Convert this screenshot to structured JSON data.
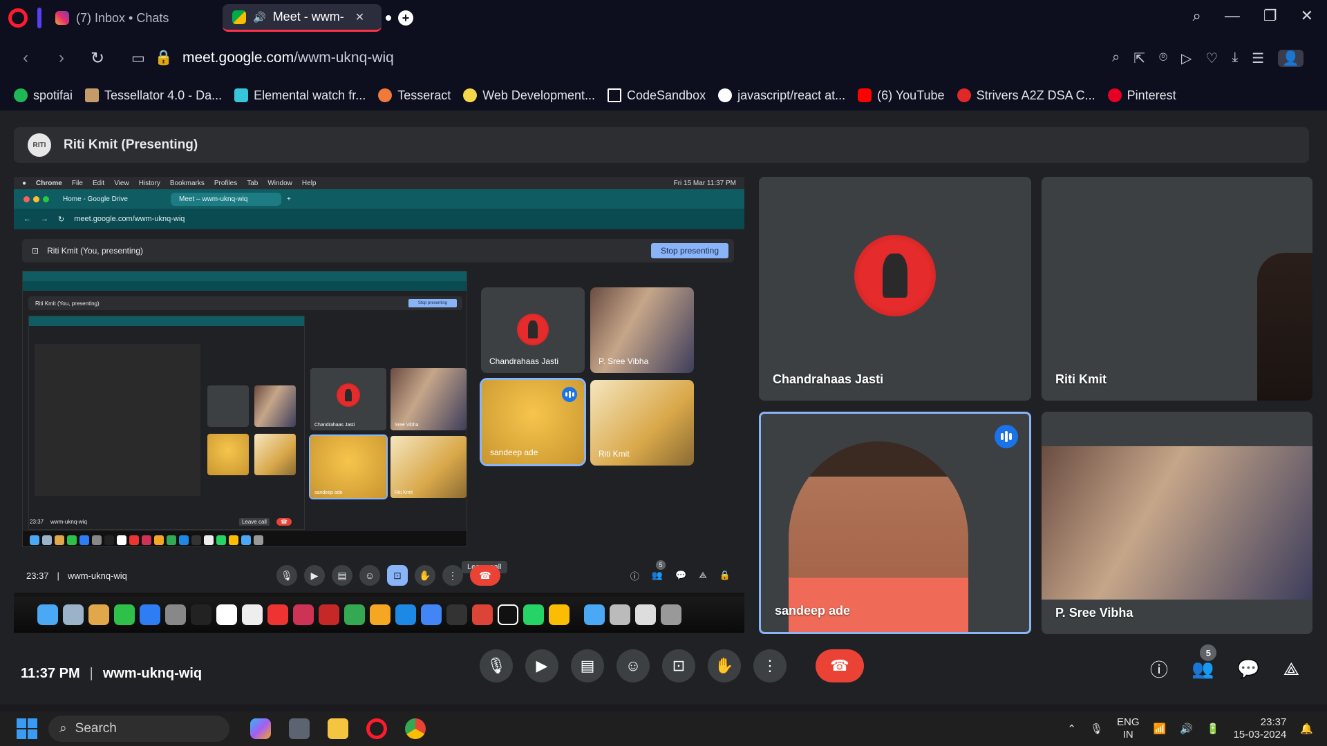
{
  "browser": {
    "tabs": [
      {
        "label": "(7) Inbox • Chats",
        "active": false
      },
      {
        "label": "Meet - wwm-",
        "active": true
      }
    ],
    "url_host": "meet.google.com",
    "url_path": "/wwm-uknq-wiq",
    "bookmarks": [
      "spotifai",
      "Tessellator 4.0 - Da...",
      "Elemental watch fr...",
      "Tesseract",
      "Web Development...",
      "CodeSandbox",
      "javascript/react at...",
      "(6) YouTube",
      "Strivers A2Z DSA C...",
      "Pinterest"
    ]
  },
  "meet": {
    "presenter_avatar_text": "RITI",
    "presenter_bar": "Riti Kmit (Presenting)",
    "shared_screen": {
      "menubar": [
        "Chrome",
        "File",
        "Edit",
        "View",
        "History",
        "Bookmarks",
        "Profiles",
        "Tab",
        "Window",
        "Help"
      ],
      "menubar_clock": "Fri 15 Mar  11:37 PM",
      "inner_tabs": [
        "Home - Google Drive",
        "Meet – wwm-uknq-wiq"
      ],
      "inner_url": "meet.google.com/wwm-uknq-wiq",
      "inner_presenting": "Riti Kmit (You, presenting)",
      "stop_presenting": "Stop presenting",
      "nested_presenting": "Riti Kmit (You, presenting)",
      "nested_stop": "Stop presenting",
      "nested_time": "23:37",
      "nested_code": "wwm-uknq-wiq",
      "nested_leave_tooltip": "Leave call",
      "nested_tiles": [
        "Chandrahaas Jasti",
        "Sree Vibha",
        "sandeep ade",
        "Riti Kmit"
      ],
      "inner_tiles": [
        {
          "name": "Chandrahaas Jasti"
        },
        {
          "name": "P. Sree Vibha"
        },
        {
          "name": "sandeep ade"
        },
        {
          "name": "Riti Kmit"
        }
      ],
      "inner_time": "23:37",
      "inner_code": "wwm-uknq-wiq",
      "participants_badge": "5",
      "leave_tooltip": "Leave call"
    },
    "participants": [
      {
        "name": "Chandrahaas Jasti"
      },
      {
        "name": "Riti Kmit"
      },
      {
        "name": "sandeep ade"
      },
      {
        "name": "P. Sree Vibha"
      }
    ],
    "time": "11:37 PM",
    "sep": "|",
    "code": "wwm-uknq-wiq",
    "participants_badge": "5"
  },
  "taskbar": {
    "search": "Search",
    "lang": "ENG",
    "region": "IN",
    "time": "23:37",
    "date": "15-03-2024"
  }
}
